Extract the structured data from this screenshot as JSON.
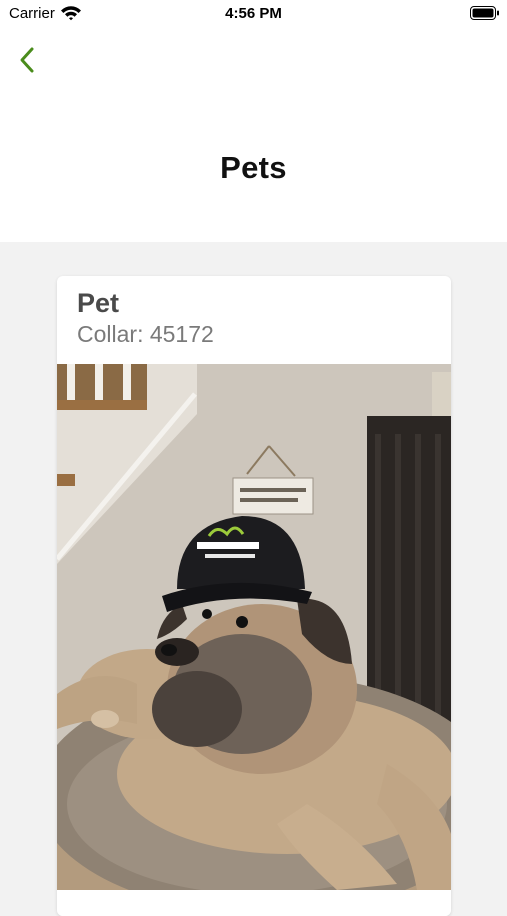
{
  "status_bar": {
    "carrier": "Carrier",
    "time": "4:56 PM",
    "wifi_icon": "wifi-icon",
    "battery_icon": "battery-icon"
  },
  "nav": {
    "back_icon": "chevron-left-icon",
    "accent_color": "#4a8c1c"
  },
  "page": {
    "title": "Pets"
  },
  "pet_card": {
    "name": "Pet",
    "collar": "Collar: 45172",
    "photo": {
      "sign_text": "CAUTION: DOG HAS A LICKER PROBLEM!",
      "cap_logo": "DogWatch HIDDEN FENCES"
    }
  }
}
